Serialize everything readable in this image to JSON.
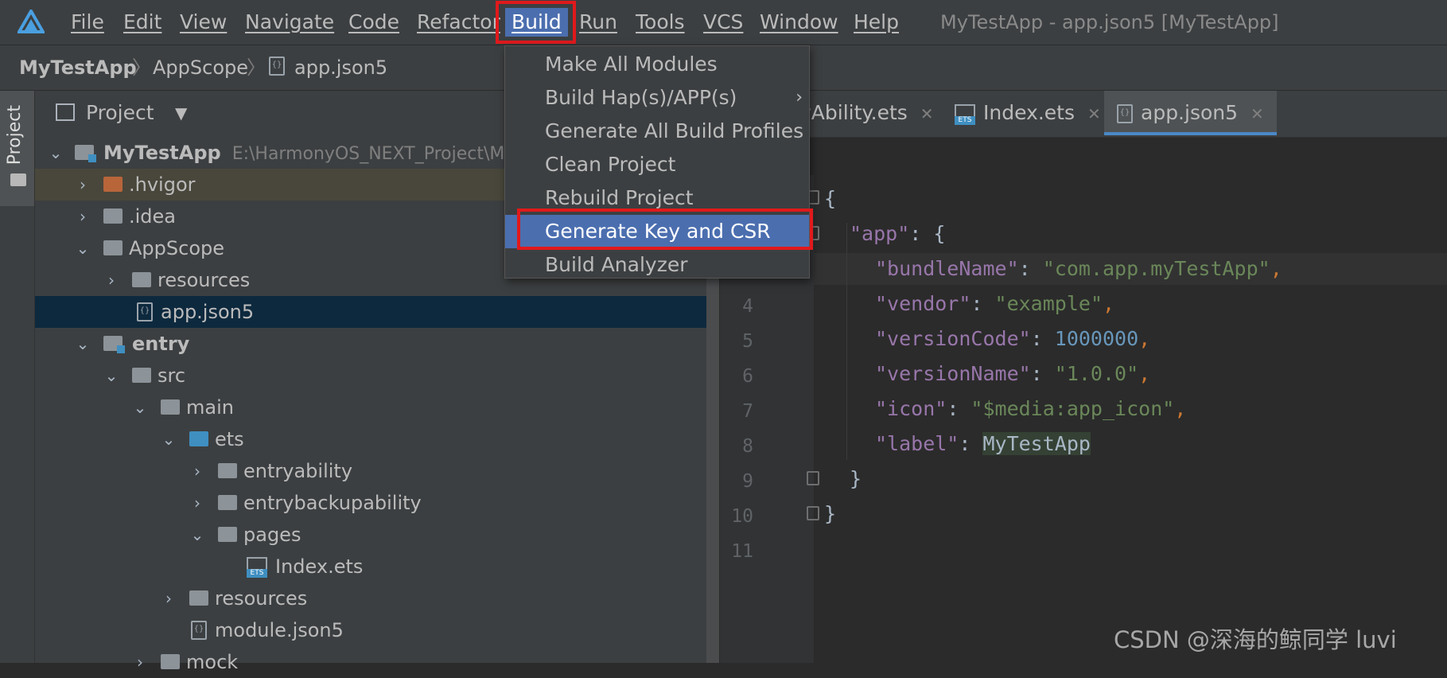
{
  "menubar": {
    "items": [
      "File",
      "Edit",
      "View",
      "Navigate",
      "Code",
      "Refactor",
      "Build",
      "Run",
      "Tools",
      "VCS",
      "Window",
      "Help"
    ],
    "window_title": "MyTestApp - app.json5 [MyTestApp]"
  },
  "breadcrumb": [
    "MyTestApp",
    "AppScope",
    "app.json5"
  ],
  "toolstripe": {
    "label": "Project"
  },
  "project_panel": {
    "title": "Project",
    "root": {
      "name": "MyTestApp",
      "path": "E:\\HarmonyOS_NEXT_Project\\M"
    },
    "rows": [
      ".hvigor",
      ".idea",
      "AppScope",
      "resources",
      "app.json5",
      "entry",
      "src",
      "main",
      "ets",
      "entryability",
      "entrybackupability",
      "pages",
      "Index.ets",
      "resources",
      "module.json5",
      "mock"
    ]
  },
  "editor": {
    "tabs": [
      "yAbility.ets",
      "Index.ets",
      "app.json5"
    ],
    "line_numbers": [
      "4",
      "5",
      "6",
      "7",
      "8",
      "9",
      "10",
      "11"
    ],
    "code": {
      "open_brace": "{",
      "app_key": "\"app\"",
      "app_rest": ": {",
      "bundleName_key": "\"bundleName\"",
      "bundleName_val": "\"com.app.myTestApp\"",
      "vendor_key": "\"vendor\"",
      "vendor_val": "\"example\"",
      "versionCode_key": "\"versionCode\"",
      "versionCode_val": "1000000",
      "versionName_key": "\"versionName\"",
      "versionName_val": "\"1.0.0\"",
      "icon_key": "\"icon\"",
      "icon_val": "\"$media:app_icon\"",
      "label_key": "\"label\"",
      "label_val": "MyTestApp",
      "colon": ": ",
      "comma": ",",
      "close_inner": "}",
      "close_outer": "}"
    }
  },
  "build_menu": {
    "items": [
      "Make All Modules",
      "Build Hap(s)/APP(s)",
      "Generate All Build Profiles",
      "Clean Project",
      "Rebuild Project",
      "Generate Key and CSR",
      "Build Analyzer"
    ],
    "submenu_arrow": "›",
    "active_item": "Generate Key and CSR"
  },
  "watermark": "CSDN @深海的鲸同学 luvi",
  "colors": {
    "menu_active": "#4b6eaf",
    "highlight_box": "#e0191c",
    "selection": "#0d293e"
  }
}
